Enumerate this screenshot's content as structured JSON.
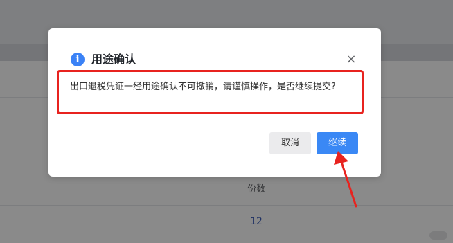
{
  "background": {
    "column_header": "份数",
    "cell_value": "12"
  },
  "dialog": {
    "title": "用途确认",
    "info_icon_glyph": "i",
    "close_glyph": "×",
    "message": "出口退税凭证一经用途确认不可撤销，请谨慎操作，是否继续提交?",
    "cancel_label": "取消",
    "confirm_label": "继续"
  },
  "colors": {
    "overlay": "rgba(0,0,0,0.46)",
    "primary": "#3a88f5",
    "annotation": "#e8231f"
  },
  "icons": [
    "info-icon",
    "close-icon"
  ]
}
